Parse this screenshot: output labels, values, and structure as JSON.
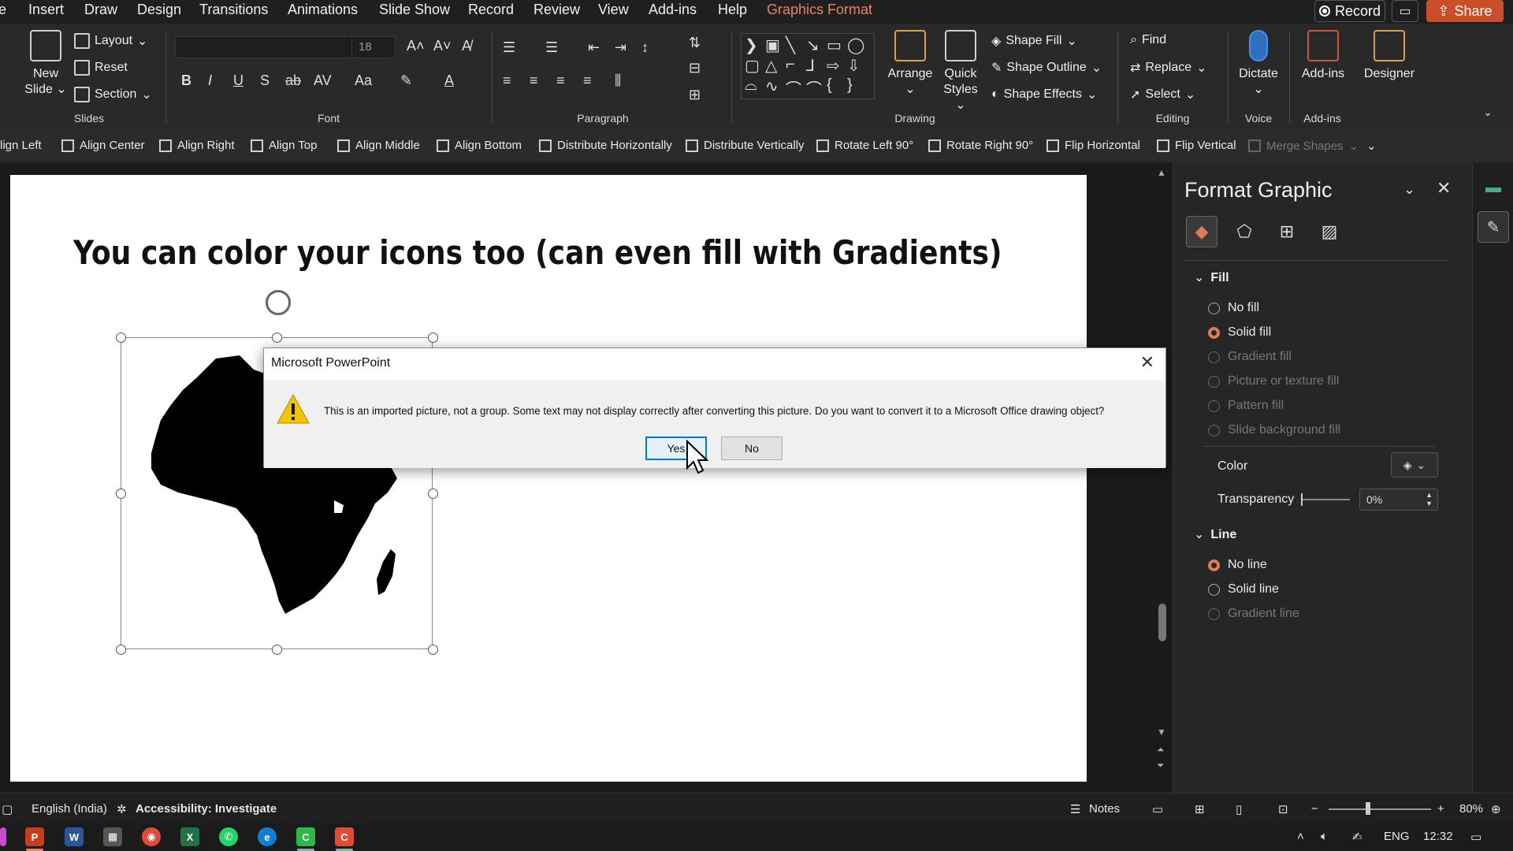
{
  "menu": {
    "tabs": [
      "e",
      "Insert",
      "Draw",
      "Design",
      "Transitions",
      "Animations",
      "Slide Show",
      "Record",
      "Review",
      "View",
      "Add-ins",
      "Help",
      "Graphics Format"
    ],
    "record_label": "Record",
    "share_label": "Share"
  },
  "ribbon": {
    "slides": {
      "new_slide": "New",
      "new_slide2": "Slide",
      "layout": "Layout",
      "reset": "Reset",
      "section": "Section",
      "label": "Slides"
    },
    "font": {
      "size": "18",
      "label": "Font"
    },
    "paragraph": {
      "label": "Paragraph"
    },
    "drawing": {
      "arrange": "Arrange",
      "quick_styles": "Quick",
      "quick_styles2": "Styles",
      "shape_fill": "Shape Fill",
      "shape_outline": "Shape Outline",
      "shape_effects": "Shape Effects",
      "label": "Drawing"
    },
    "editing": {
      "find": "Find",
      "replace": "Replace",
      "select": "Select",
      "label": "Editing"
    },
    "voice": {
      "dictate": "Dictate",
      "label": "Voice"
    },
    "addins": {
      "addins": "Add-ins",
      "label": "Add-ins"
    },
    "designer": {
      "designer": "Designer"
    }
  },
  "arrange_bar": [
    "lign Left",
    "Align Center",
    "Align Right",
    "Align Top",
    "Align Middle",
    "Align Bottom",
    "Distribute Horizontally",
    "Distribute Vertically",
    "Rotate Left 90°",
    "Rotate Right 90°",
    "Flip Horizontal",
    "Flip Vertical",
    "Merge Shapes"
  ],
  "slide": {
    "title": "You can color your icons too (can even fill with Gradients)"
  },
  "dialog": {
    "title": "Microsoft PowerPoint",
    "message": "This is an imported picture, not a group. Some text may not display correctly after converting this picture. Do you want to convert it to a Microsoft Office drawing object?",
    "yes": "Yes",
    "no": "No"
  },
  "pane": {
    "title": "Format Graphic",
    "fill_section": "Fill",
    "fill_options": [
      {
        "label": "No fill",
        "state": "off"
      },
      {
        "label": "Solid fill",
        "state": "on"
      },
      {
        "label": "Gradient fill",
        "state": "disabled"
      },
      {
        "label": "Picture or texture fill",
        "state": "disabled"
      },
      {
        "label": "Pattern fill",
        "state": "disabled"
      },
      {
        "label": "Slide background fill",
        "state": "disabled"
      }
    ],
    "color_label": "Color",
    "transparency_label": "Transparency",
    "transparency_value": "0%",
    "line_section": "Line",
    "line_options": [
      {
        "label": "No line",
        "state": "on"
      },
      {
        "label": "Solid line",
        "state": "off"
      },
      {
        "label": "Gradient line",
        "state": "disabled"
      }
    ]
  },
  "status": {
    "language": "English (India)",
    "accessibility": "Accessibility: Investigate",
    "notes": "Notes",
    "zoom": "80%"
  },
  "taskbar": {
    "lang": "ENG",
    "time": "12:32"
  },
  "colors": {
    "accent": "#e07a58",
    "share": "#c94f2b",
    "dialog_default": "#0078d7"
  }
}
